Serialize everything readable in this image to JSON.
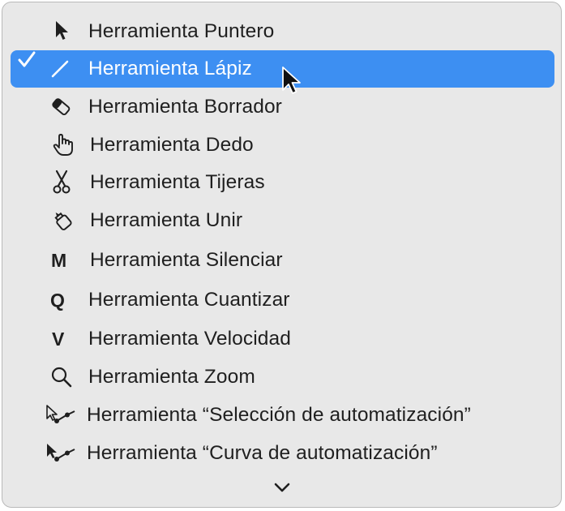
{
  "menu": {
    "items": [
      {
        "label": "Herramienta Puntero",
        "icon": "pointer-arrow-icon",
        "selected": false
      },
      {
        "label": "Herramienta Lápiz",
        "icon": "pencil-icon",
        "selected": true
      },
      {
        "label": "Herramienta Borrador",
        "icon": "eraser-icon",
        "selected": false
      },
      {
        "label": "Herramienta Dedo",
        "icon": "finger-hand-icon",
        "selected": false
      },
      {
        "label": "Herramienta Tijeras",
        "icon": "scissors-icon",
        "selected": false
      },
      {
        "label": "Herramienta Unir",
        "icon": "glue-icon",
        "selected": false
      },
      {
        "label": "Herramienta Silenciar",
        "icon": "M",
        "selected": false
      },
      {
        "label": "Herramienta Cuantizar",
        "icon": "Q",
        "selected": false
      },
      {
        "label": "Herramienta Velocidad",
        "icon": "V",
        "selected": false
      },
      {
        "label": "Herramienta Zoom",
        "icon": "magnifier-icon",
        "selected": false
      },
      {
        "label": "Herramienta “Selección de automatización”",
        "icon": "automation-select-icon",
        "selected": false
      },
      {
        "label": "Herramienta “Curva de automatización”",
        "icon": "automation-curve-icon",
        "selected": false
      }
    ]
  },
  "colors": {
    "menu_bg": "#e8e8e8",
    "selection": "#3d8ff2",
    "text": "#1f1f1f",
    "selected_text": "#ffffff"
  }
}
